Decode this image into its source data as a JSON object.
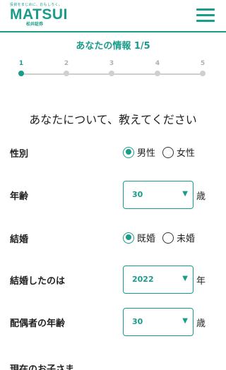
{
  "header": {
    "logo_tagline": "投資をまじめに、おもしろく。",
    "logo_main": "MATSUI",
    "logo_sub": "松井証券",
    "menu_icon": "hamburger-menu-icon",
    "brand_color": "#1a9c8a"
  },
  "step": {
    "title": "あなたの情報 1/5",
    "current": 1,
    "labels": [
      "1",
      "2",
      "3",
      "4",
      "5"
    ]
  },
  "form": {
    "heading": "あなたについて、教えてください",
    "gender": {
      "label": "性別",
      "options": [
        "男性",
        "女性"
      ],
      "selected": "男性"
    },
    "age": {
      "label": "年齢",
      "value": "30",
      "unit": "歳"
    },
    "marriage": {
      "label": "結婚",
      "options": [
        "既婚",
        "未婚"
      ],
      "selected": "既婚"
    },
    "married_year": {
      "label": "結婚したのは",
      "value": "2022",
      "unit": "年"
    },
    "spouse_age": {
      "label": "配偶者の年齢",
      "value": "30",
      "unit": "歳"
    },
    "children_label": "現在のお子さま"
  }
}
